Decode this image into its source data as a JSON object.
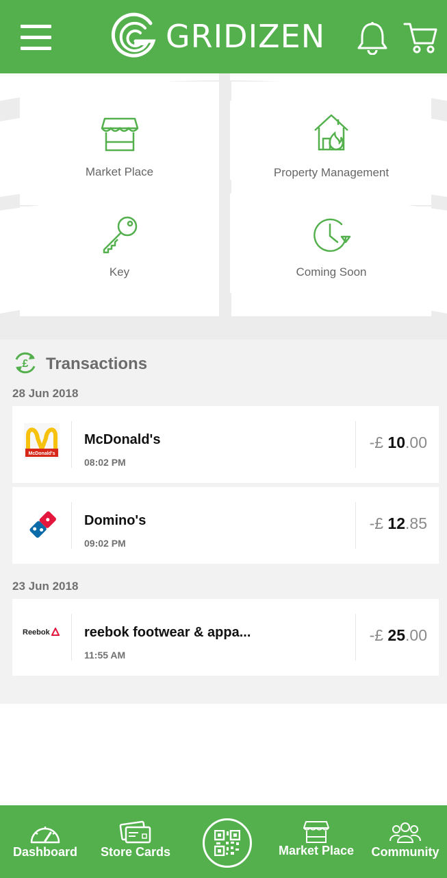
{
  "header": {
    "brand": "GRIDIZEN",
    "menu_icon": "hamburger-menu-icon",
    "notifications_icon": "bell-icon",
    "cart_icon": "shopping-cart-icon"
  },
  "tiles": [
    {
      "label": "Market Place",
      "icon": "storefront-icon"
    },
    {
      "label": "Property Management",
      "icon": "house-flame-icon"
    },
    {
      "label": "Key",
      "icon": "key-icon"
    },
    {
      "label": "Coming Soon",
      "icon": "clock-icon"
    }
  ],
  "transactions": {
    "title": "Transactions",
    "icon": "pound-exchange-icon",
    "groups": [
      {
        "date": "28 Jun 2018",
        "items": [
          {
            "merchant": "McDonald's",
            "time": "08:02 PM",
            "currency": "-£",
            "amount_whole": "10",
            "amount_fraction": ".00",
            "logo": "mcdonalds-logo"
          },
          {
            "merchant": "Domino's",
            "time": "09:02 PM",
            "currency": "-£",
            "amount_whole": "12",
            "amount_fraction": ".85",
            "logo": "dominos-logo"
          }
        ]
      },
      {
        "date": "23 Jun 2018",
        "items": [
          {
            "merchant": "reebok footwear & appa...",
            "time": "11:55 AM",
            "currency": "-£",
            "amount_whole": "25",
            "amount_fraction": ".00",
            "logo": "reebok-logo",
            "logo_text": "Reebok"
          }
        ]
      }
    ]
  },
  "mcdonalds_logo_text": "McDonald's",
  "bottom_nav": [
    {
      "label": "Dashboard",
      "icon": "speedometer-icon"
    },
    {
      "label": "Store Cards",
      "icon": "cards-icon"
    },
    {
      "label": "",
      "icon": "qr-code-icon"
    },
    {
      "label": "Market Place",
      "icon": "storefront-icon"
    },
    {
      "label": "Community",
      "icon": "people-icon"
    }
  ],
  "colors": {
    "brand_green": "#53b04d",
    "background_grey": "#f2f2f2",
    "text_dark": "#111111",
    "text_muted": "#707070"
  }
}
